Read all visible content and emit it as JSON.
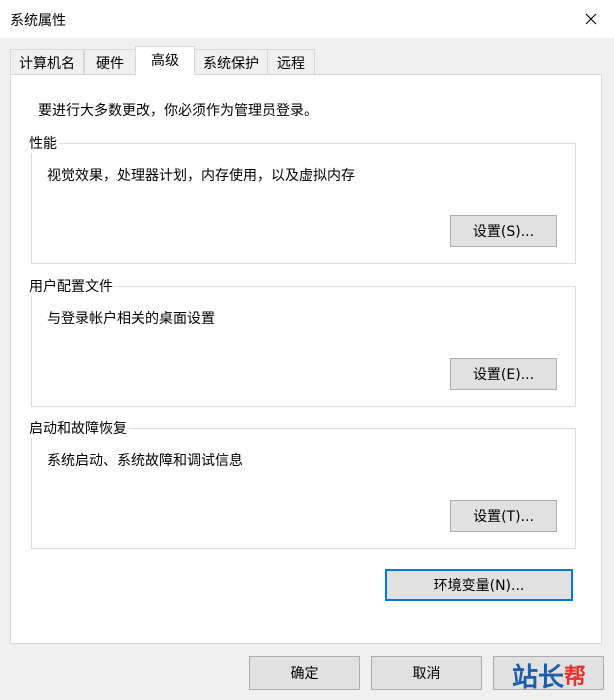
{
  "window": {
    "title": "系统属性"
  },
  "tabs": [
    {
      "label": "计算机名",
      "active": false
    },
    {
      "label": "硬件",
      "active": false
    },
    {
      "label": "高级",
      "active": true
    },
    {
      "label": "系统保护",
      "active": false
    },
    {
      "label": "远程",
      "active": false
    }
  ],
  "advanced": {
    "notice": "要进行大多数更改，你必须作为管理员登录。",
    "performance": {
      "title": "性能",
      "description": "视觉效果，处理器计划，内存使用，以及虚拟内存",
      "button": "设置(S)..."
    },
    "user_profiles": {
      "title": "用户配置文件",
      "description": "与登录帐户相关的桌面设置",
      "button": "设置(E)..."
    },
    "startup_recovery": {
      "title": "启动和故障恢复",
      "description": "系统启动、系统故障和调试信息",
      "button": "设置(T)..."
    },
    "env_button": "环境变量(N)..."
  },
  "footer": {
    "ok": "确定",
    "cancel": "取消"
  },
  "watermark": {
    "text_a": "站长",
    "text_b": "帮"
  },
  "icons": {
    "close": "close-icon"
  },
  "colors": {
    "accent": "#0078d7",
    "button_bg": "#e1e1e1",
    "panel_bg": "#ffffff",
    "window_bg": "#f0f0f0"
  }
}
